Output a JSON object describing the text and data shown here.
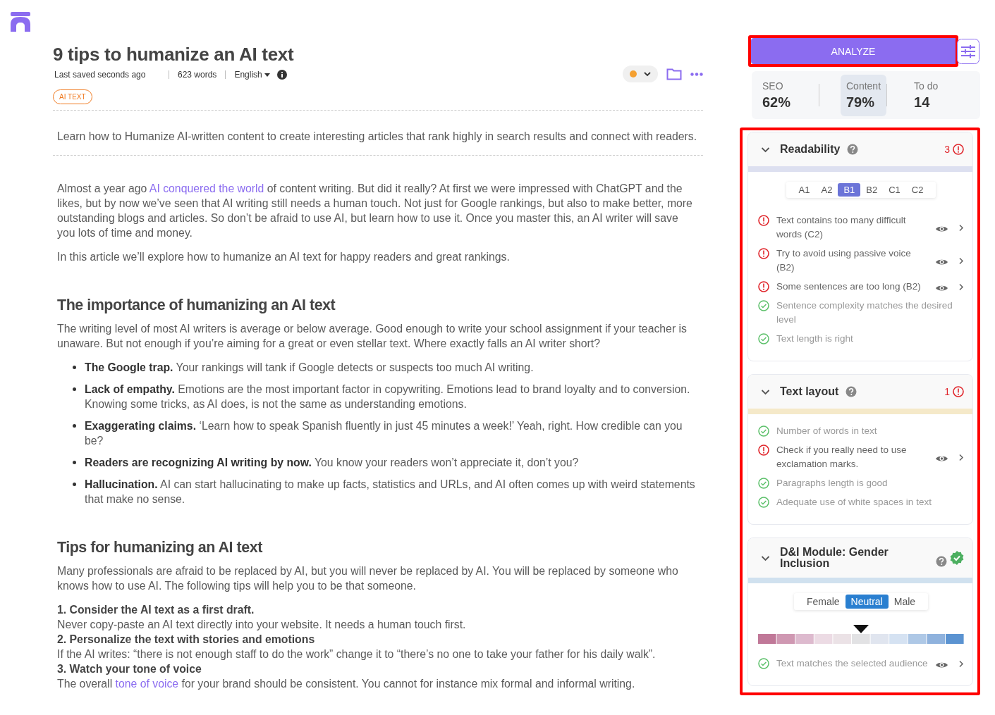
{
  "document": {
    "title": "9 tips to humanize an AI text",
    "saved": "Last saved seconds ago",
    "words": "623 words",
    "language": "English",
    "tag": "AI TEXT",
    "status_dot": {
      "color": "#f5a030"
    }
  },
  "intro": "Learn how to Humanize AI-written content to create interesting articles that rank highly in search results and connect with readers.",
  "blocks": [
    {
      "kind": "p",
      "segments": [
        {
          "text": "Almost a year ago "
        },
        {
          "text": "AI conquered the world",
          "link": true
        },
        {
          "text": " of content writing. But did it really? At first we were impressed with ChatGPT and the likes, but by now we’ve seen that AI writing still needs a human touch. Not just for Google rankings, but also to make better, more outstanding blogs and articles. So don’t be afraid to use AI, but learn how to use it. Once you master this, an AI writer will save you lots of time and money."
        }
      ]
    },
    {
      "kind": "p",
      "segments": [
        {
          "text": "In this article we’ll explore how to humanize an AI text for happy readers and great rankings."
        }
      ]
    },
    {
      "kind": "h2",
      "text": "The importance of humanizing an AI text"
    },
    {
      "kind": "p",
      "segments": [
        {
          "text": "The writing level of most AI writers is average or below average. Good enough to write your school assignment if your teacher is unaware. But not enough if you’re aiming for a great or even stellar text. Where exactly falls an AI writer short?"
        }
      ]
    },
    {
      "kind": "list",
      "items": [
        "**The Google trap.** Your rankings will tank if Google detects or suspects too much AI writing.",
        "**Lack of empathy.** Emotions are the most important factor in copywriting. Emotions lead to brand loyalty and to conversion. Knowing some tricks, as AI does, is not the same as understanding emotions.",
        "**Exaggerating claims.** ‘Learn how to speak Spanish fluently in just 45 minutes a week!’ Yeah, right. How credible can you be?",
        "**Readers are recognizing AI writing by now.** You know your readers won’t appreciate it, don’t you?",
        "**Hallucination.** AI can start hallucinating to make up facts, statistics and URLs, and AI often comes up with weird statements that make no sense."
      ]
    },
    {
      "kind": "h2",
      "text": "Tips for humanizing an AI text"
    },
    {
      "kind": "p",
      "segments": [
        {
          "text": "Many professionals are afraid to be replaced by AI, but you will never be replaced by AI. You will be replaced by someone who knows how to use AI. The following tips will help you to be that someone."
        }
      ]
    },
    {
      "kind": "step",
      "text": "1. Consider the AI text as a first draft."
    },
    {
      "kind": "line",
      "segments": [
        {
          "text": "Never copy-paste an AI text directly into your website. It needs a human touch first."
        }
      ]
    },
    {
      "kind": "step",
      "text": "2. Personalize the text with stories and emotions"
    },
    {
      "kind": "line",
      "segments": [
        {
          "text": "If the AI writes: “there is not enough staff to do the work” change it to “there’s no one to take your father for his daily walk”."
        }
      ]
    },
    {
      "kind": "step",
      "text": "3. Watch your tone of voice"
    },
    {
      "kind": "line",
      "segments": [
        {
          "text": "The overall "
        },
        {
          "text": "tone of voice",
          "link": true
        },
        {
          "text": " for your brand should be consistent. You cannot for instance mix formal and informal writing."
        }
      ]
    }
  ],
  "analyze": {
    "label": "ANALYZE",
    "highlighted": true
  },
  "scores": [
    {
      "label": "SEO",
      "value": "62%",
      "selected": false
    },
    {
      "label": "Content",
      "value": "79%",
      "selected": true
    },
    {
      "label": "To do",
      "value": "14",
      "selected": false
    }
  ],
  "checks_highlighted": true,
  "cards": [
    {
      "title": "Readability",
      "expanded": true,
      "kind": "errors",
      "count": "3",
      "color": "#dde0f0",
      "options": [
        {
          "label": "A1",
          "selected": false
        },
        {
          "label": "A2",
          "selected": false
        },
        {
          "label": "B1",
          "selected": true
        },
        {
          "label": "B2",
          "selected": false
        },
        {
          "label": "C1",
          "selected": false
        },
        {
          "label": "C2",
          "selected": false
        }
      ],
      "items": [
        {
          "kind": "error",
          "text": "Text contains too many difficult words (C2)",
          "actions": true
        },
        {
          "kind": "error",
          "text": "Try to avoid using passive voice (B2)",
          "actions": true
        },
        {
          "kind": "error",
          "text": "Some sentences are too long (B2)",
          "actions": true
        },
        {
          "kind": "ok",
          "text": "Sentence complexity matches the desired level",
          "actions": false
        },
        {
          "kind": "ok",
          "text": "Text length is right",
          "actions": false
        }
      ]
    },
    {
      "title": "Text layout",
      "expanded": true,
      "kind": "errors",
      "count": "1",
      "color": "#f5e9c9",
      "items": [
        {
          "kind": "ok",
          "text": "Number of words in text",
          "actions": false
        },
        {
          "kind": "error",
          "text": "Check if you really need to use exclamation marks.",
          "actions": true
        },
        {
          "kind": "ok",
          "text": "Paragraphs length is good",
          "actions": false
        },
        {
          "kind": "ok",
          "text": "Adequate use of white spaces in text",
          "actions": false
        }
      ]
    },
    {
      "title": "D&I Module: Gender Inclusion",
      "expanded": true,
      "kind": "passed",
      "color": "#d0e1ef",
      "options": [
        {
          "label": "Female",
          "selected": false
        },
        {
          "label": "Neutral",
          "selected": true
        },
        {
          "label": "Male",
          "selected": false
        }
      ],
      "scale": {
        "level": 0.5
      },
      "items": [
        {
          "kind": "ok",
          "text": "Text matches the selected audience",
          "actions": true
        }
      ]
    }
  ]
}
